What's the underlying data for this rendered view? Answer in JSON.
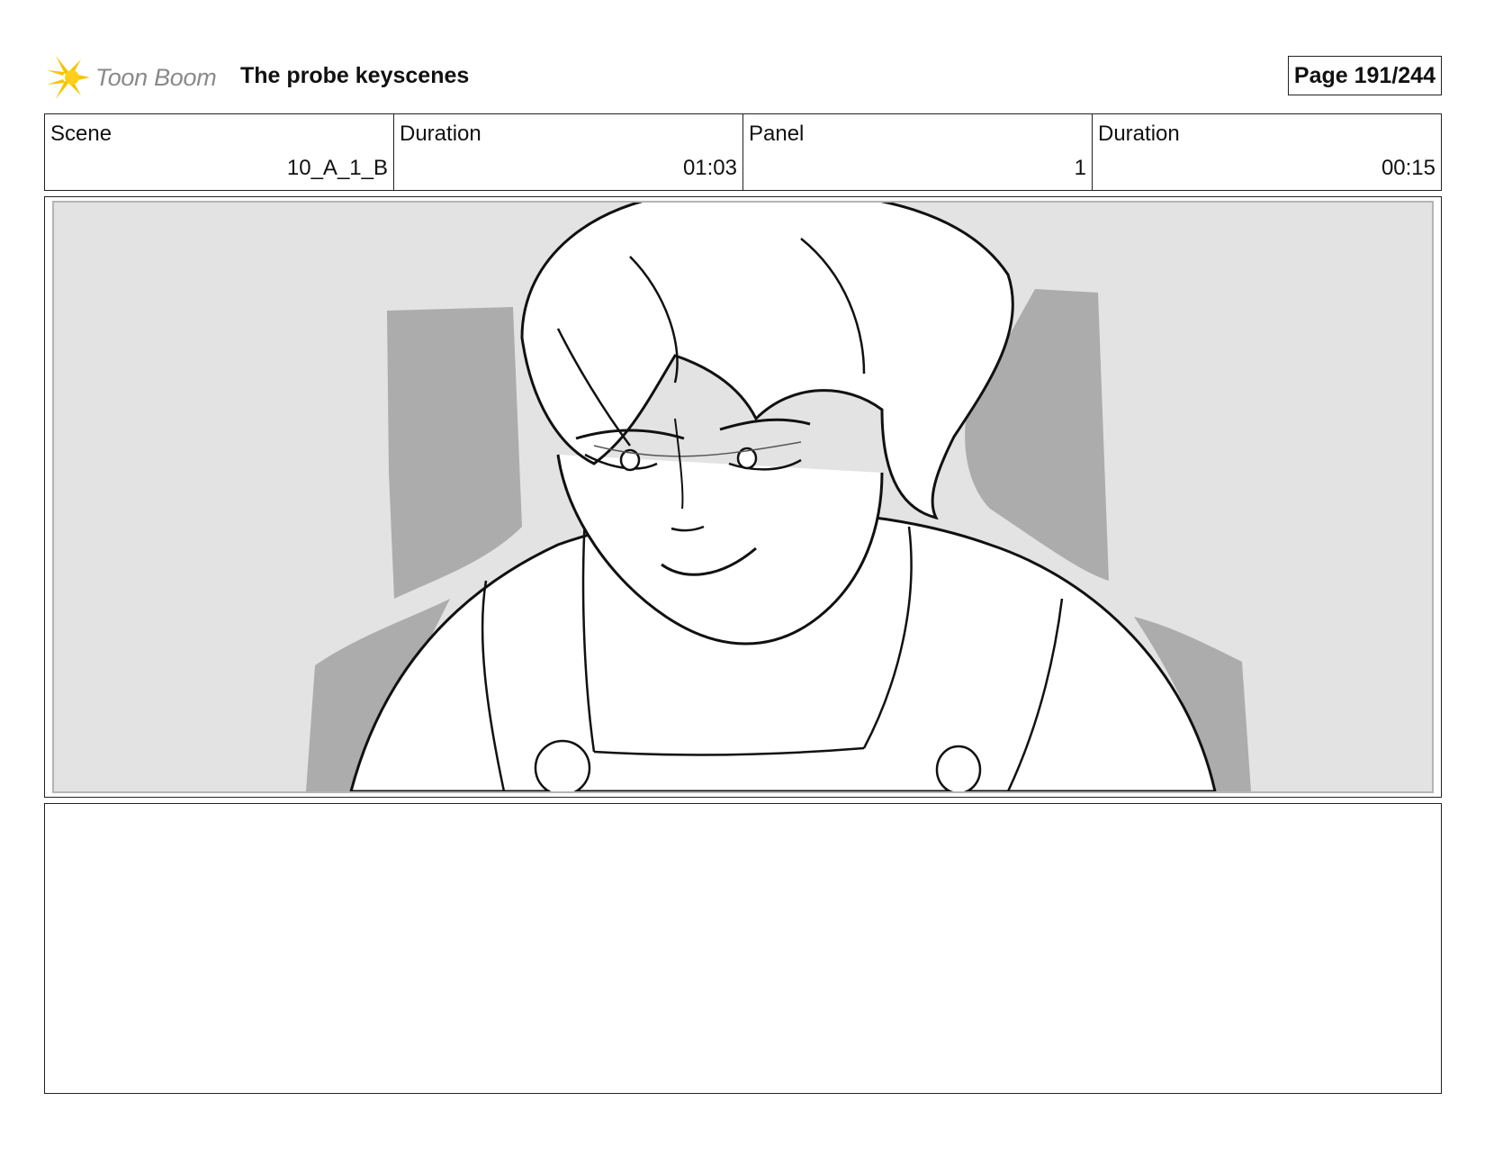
{
  "header": {
    "logo_text": "Toon Boom",
    "title": "The probe keyscenes",
    "page_label": "Page 191/244"
  },
  "info": {
    "scene_label": "Scene",
    "scene_value": "10_A_1_B",
    "scene_duration_label": "Duration",
    "scene_duration_value": "01:03",
    "panel_label": "Panel",
    "panel_value": "1",
    "panel_duration_label": "Duration",
    "panel_duration_value": "00:15"
  },
  "panel": {
    "icon": "storyboard-sketch-image"
  },
  "notes": {
    "text": ""
  },
  "colors": {
    "logo_accent": "#f5c400",
    "background_gray": "#e3e3e3",
    "shadow_gray": "#acacac"
  }
}
